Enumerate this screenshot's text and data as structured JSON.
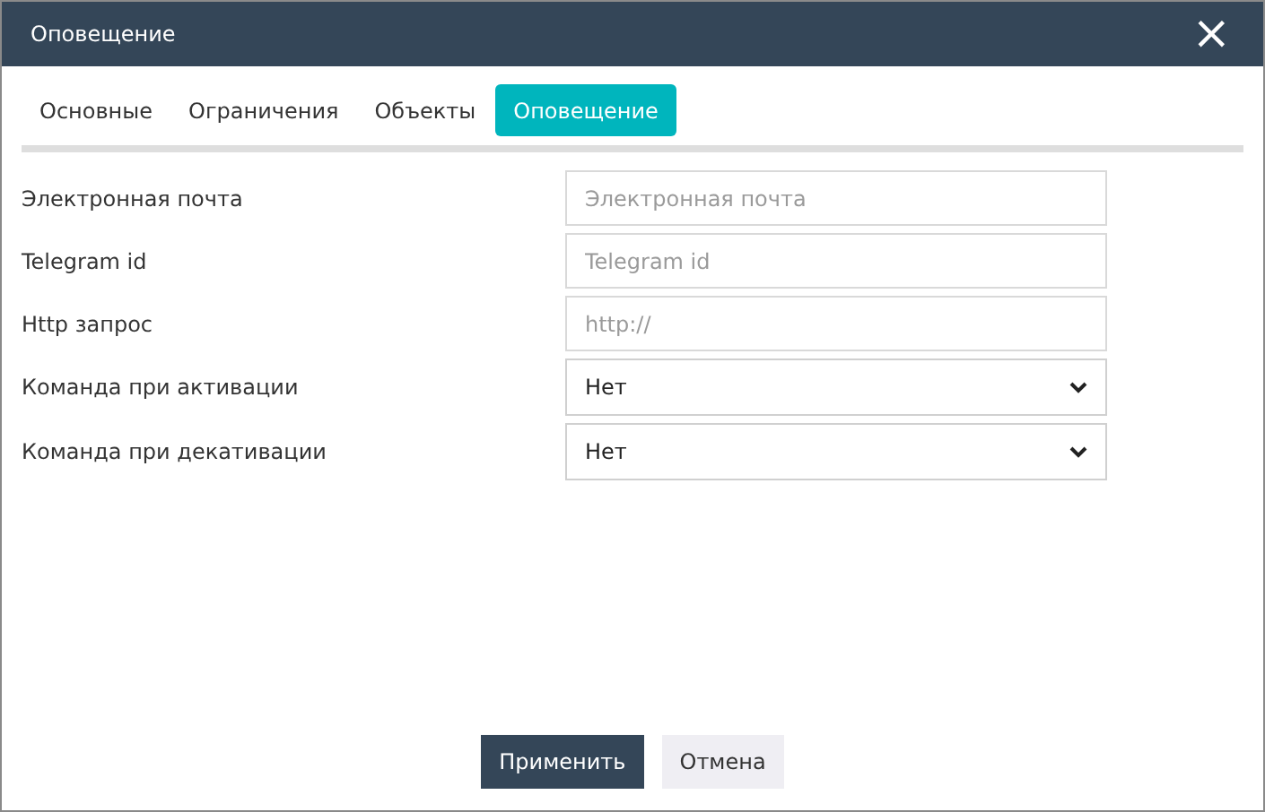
{
  "window": {
    "title": "Оповещение",
    "close": "×"
  },
  "tabs": [
    {
      "label": "Основные",
      "selected": false
    },
    {
      "label": "Ограничения",
      "selected": false
    },
    {
      "label": "Объекты",
      "selected": false
    },
    {
      "label": "Оповещение",
      "selected": true
    }
  ],
  "fields": [
    {
      "label": "Электронная почта",
      "kind": "text",
      "placeholder": "Электронная почта"
    },
    {
      "label": "Telegram id",
      "kind": "text",
      "placeholder": "Telegram id"
    },
    {
      "label": "Http запрос",
      "kind": "text",
      "placeholder": "http://"
    },
    {
      "label": "Команда при активации",
      "kind": "select",
      "value": "Нет"
    },
    {
      "label": "Команда при декативации",
      "kind": "select",
      "value": "Нет"
    }
  ],
  "buttons": [
    {
      "label": "Применить",
      "kind": "primary"
    },
    {
      "label": "Отмена",
      "kind": "secondary"
    }
  ]
}
